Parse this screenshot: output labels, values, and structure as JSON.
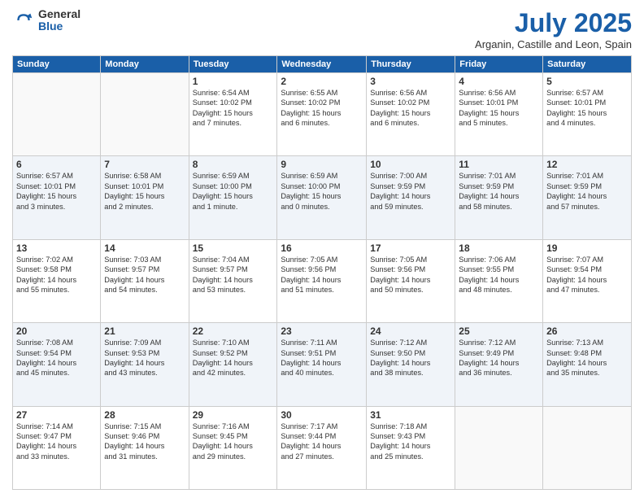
{
  "logo": {
    "general": "General",
    "blue": "Blue"
  },
  "title": "July 2025",
  "subtitle": "Arganin, Castille and Leon, Spain",
  "headers": [
    "Sunday",
    "Monday",
    "Tuesday",
    "Wednesday",
    "Thursday",
    "Friday",
    "Saturday"
  ],
  "weeks": [
    [
      {
        "day": "",
        "info": ""
      },
      {
        "day": "",
        "info": ""
      },
      {
        "day": "1",
        "info": "Sunrise: 6:54 AM\nSunset: 10:02 PM\nDaylight: 15 hours\nand 7 minutes."
      },
      {
        "day": "2",
        "info": "Sunrise: 6:55 AM\nSunset: 10:02 PM\nDaylight: 15 hours\nand 6 minutes."
      },
      {
        "day": "3",
        "info": "Sunrise: 6:56 AM\nSunset: 10:02 PM\nDaylight: 15 hours\nand 6 minutes."
      },
      {
        "day": "4",
        "info": "Sunrise: 6:56 AM\nSunset: 10:01 PM\nDaylight: 15 hours\nand 5 minutes."
      },
      {
        "day": "5",
        "info": "Sunrise: 6:57 AM\nSunset: 10:01 PM\nDaylight: 15 hours\nand 4 minutes."
      }
    ],
    [
      {
        "day": "6",
        "info": "Sunrise: 6:57 AM\nSunset: 10:01 PM\nDaylight: 15 hours\nand 3 minutes."
      },
      {
        "day": "7",
        "info": "Sunrise: 6:58 AM\nSunset: 10:01 PM\nDaylight: 15 hours\nand 2 minutes."
      },
      {
        "day": "8",
        "info": "Sunrise: 6:59 AM\nSunset: 10:00 PM\nDaylight: 15 hours\nand 1 minute."
      },
      {
        "day": "9",
        "info": "Sunrise: 6:59 AM\nSunset: 10:00 PM\nDaylight: 15 hours\nand 0 minutes."
      },
      {
        "day": "10",
        "info": "Sunrise: 7:00 AM\nSunset: 9:59 PM\nDaylight: 14 hours\nand 59 minutes."
      },
      {
        "day": "11",
        "info": "Sunrise: 7:01 AM\nSunset: 9:59 PM\nDaylight: 14 hours\nand 58 minutes."
      },
      {
        "day": "12",
        "info": "Sunrise: 7:01 AM\nSunset: 9:59 PM\nDaylight: 14 hours\nand 57 minutes."
      }
    ],
    [
      {
        "day": "13",
        "info": "Sunrise: 7:02 AM\nSunset: 9:58 PM\nDaylight: 14 hours\nand 55 minutes."
      },
      {
        "day": "14",
        "info": "Sunrise: 7:03 AM\nSunset: 9:57 PM\nDaylight: 14 hours\nand 54 minutes."
      },
      {
        "day": "15",
        "info": "Sunrise: 7:04 AM\nSunset: 9:57 PM\nDaylight: 14 hours\nand 53 minutes."
      },
      {
        "day": "16",
        "info": "Sunrise: 7:05 AM\nSunset: 9:56 PM\nDaylight: 14 hours\nand 51 minutes."
      },
      {
        "day": "17",
        "info": "Sunrise: 7:05 AM\nSunset: 9:56 PM\nDaylight: 14 hours\nand 50 minutes."
      },
      {
        "day": "18",
        "info": "Sunrise: 7:06 AM\nSunset: 9:55 PM\nDaylight: 14 hours\nand 48 minutes."
      },
      {
        "day": "19",
        "info": "Sunrise: 7:07 AM\nSunset: 9:54 PM\nDaylight: 14 hours\nand 47 minutes."
      }
    ],
    [
      {
        "day": "20",
        "info": "Sunrise: 7:08 AM\nSunset: 9:54 PM\nDaylight: 14 hours\nand 45 minutes."
      },
      {
        "day": "21",
        "info": "Sunrise: 7:09 AM\nSunset: 9:53 PM\nDaylight: 14 hours\nand 43 minutes."
      },
      {
        "day": "22",
        "info": "Sunrise: 7:10 AM\nSunset: 9:52 PM\nDaylight: 14 hours\nand 42 minutes."
      },
      {
        "day": "23",
        "info": "Sunrise: 7:11 AM\nSunset: 9:51 PM\nDaylight: 14 hours\nand 40 minutes."
      },
      {
        "day": "24",
        "info": "Sunrise: 7:12 AM\nSunset: 9:50 PM\nDaylight: 14 hours\nand 38 minutes."
      },
      {
        "day": "25",
        "info": "Sunrise: 7:12 AM\nSunset: 9:49 PM\nDaylight: 14 hours\nand 36 minutes."
      },
      {
        "day": "26",
        "info": "Sunrise: 7:13 AM\nSunset: 9:48 PM\nDaylight: 14 hours\nand 35 minutes."
      }
    ],
    [
      {
        "day": "27",
        "info": "Sunrise: 7:14 AM\nSunset: 9:47 PM\nDaylight: 14 hours\nand 33 minutes."
      },
      {
        "day": "28",
        "info": "Sunrise: 7:15 AM\nSunset: 9:46 PM\nDaylight: 14 hours\nand 31 minutes."
      },
      {
        "day": "29",
        "info": "Sunrise: 7:16 AM\nSunset: 9:45 PM\nDaylight: 14 hours\nand 29 minutes."
      },
      {
        "day": "30",
        "info": "Sunrise: 7:17 AM\nSunset: 9:44 PM\nDaylight: 14 hours\nand 27 minutes."
      },
      {
        "day": "31",
        "info": "Sunrise: 7:18 AM\nSunset: 9:43 PM\nDaylight: 14 hours\nand 25 minutes."
      },
      {
        "day": "",
        "info": ""
      },
      {
        "day": "",
        "info": ""
      }
    ]
  ]
}
